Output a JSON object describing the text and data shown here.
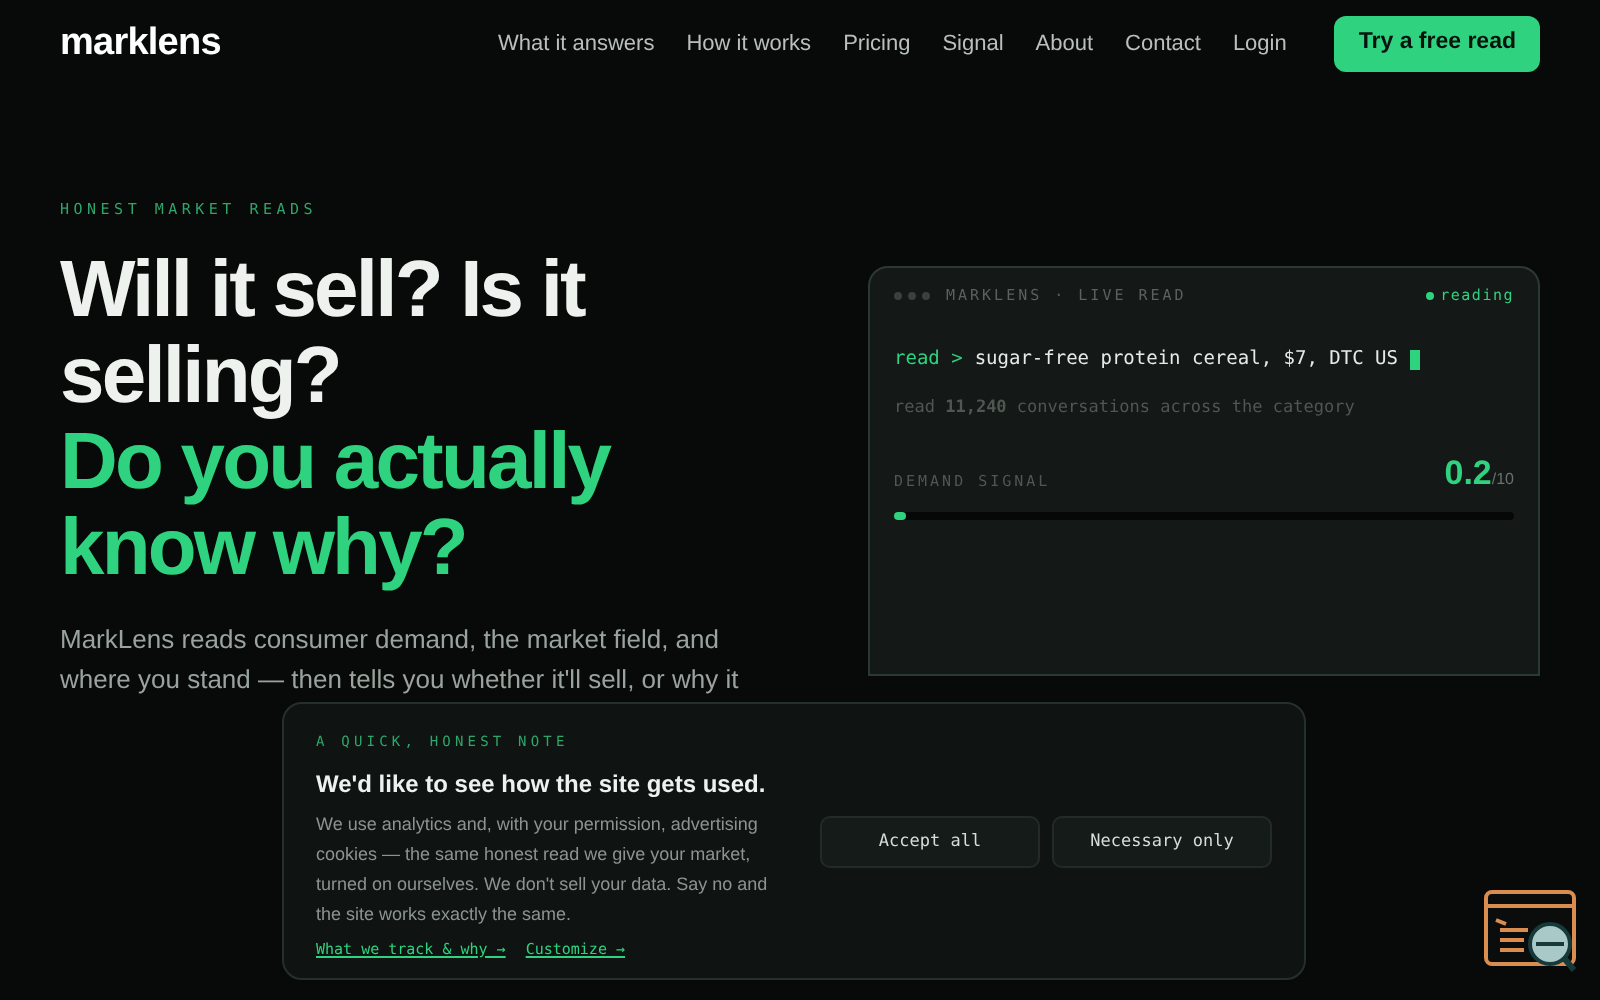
{
  "logo": "marklens",
  "nav": [
    {
      "label": "What it answers"
    },
    {
      "label": "How it works"
    },
    {
      "label": "Pricing"
    },
    {
      "label": "Signal"
    },
    {
      "label": "About"
    },
    {
      "label": "Contact"
    },
    {
      "label": "Login"
    }
  ],
  "cta": "Try a free read",
  "hero": {
    "eyebrow": "HONEST MARKET READS",
    "headline": [
      {
        "text": "Will it sell? Is it selling?",
        "accent": false
      },
      {
        "text": "Do you actually know why?",
        "accent": true
      }
    ],
    "paragraph": "MarkLens reads consumer demand, the market field, and where you stand — then tells you whether it'll sell, or why it"
  },
  "terminal": {
    "title": "MARKLENS · LIVE READ",
    "status": "reading",
    "prompt": "read >",
    "query": "sugar-free protein cereal, $7, DTC US",
    "summary": "read **11,240** conversations across the category",
    "metric_label": "DEMAND SIGNAL",
    "score": "0.2",
    "score_max": "/10",
    "level": 0.02
  },
  "cookie_banner": {
    "eyebrow": "A QUICK, HONEST NOTE",
    "title": "We'd like to see how the site gets used.",
    "body": "We use analytics and, with your permission, advertising cookies — the same honest read we give your market, turned on ourselves. We don't sell your data. Say no and the site works exactly the same.",
    "links": [
      "What we track & why →",
      "Customize →"
    ],
    "buttons": [
      "Accept all",
      "Necessary only"
    ]
  }
}
